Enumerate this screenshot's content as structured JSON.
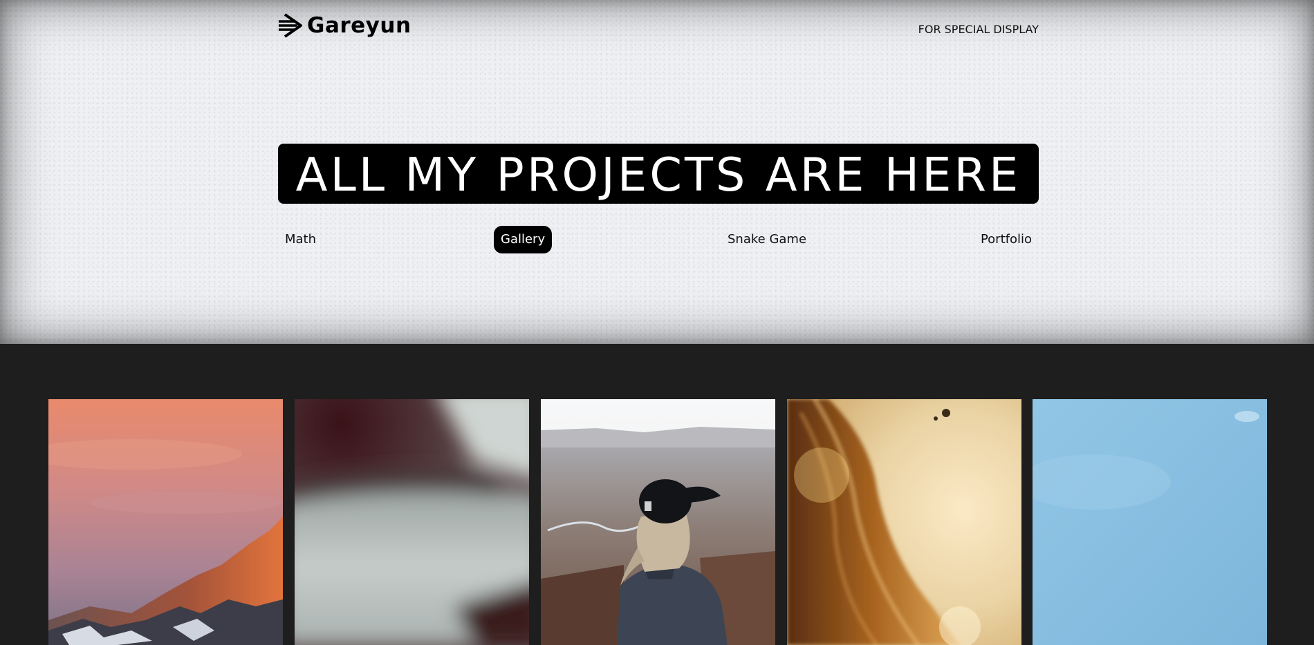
{
  "header": {
    "brand": "Gareyun",
    "logo_icon": "arrow-logo-icon",
    "nav_link": "FOR SPECIAL DISPLAY"
  },
  "hero": {
    "headline": "ALL MY PROJECTS ARE HERE"
  },
  "tabs": [
    {
      "label": "Math",
      "active": false
    },
    {
      "label": "Gallery",
      "active": true
    },
    {
      "label": "Snake Game",
      "active": false
    },
    {
      "label": "Portfolio",
      "active": false
    }
  ],
  "gallery": {
    "images": [
      {
        "name": "sunset-mountain-photo"
      },
      {
        "name": "blurred-abstract-photo"
      },
      {
        "name": "woman-cap-canyon-photo"
      },
      {
        "name": "hair-sunlight-photo"
      },
      {
        "name": "blue-sky-photo"
      }
    ]
  },
  "colors": {
    "hero_bg": "#eef0f3",
    "page_bg": "#1e1e1e",
    "accent": "#000000"
  }
}
